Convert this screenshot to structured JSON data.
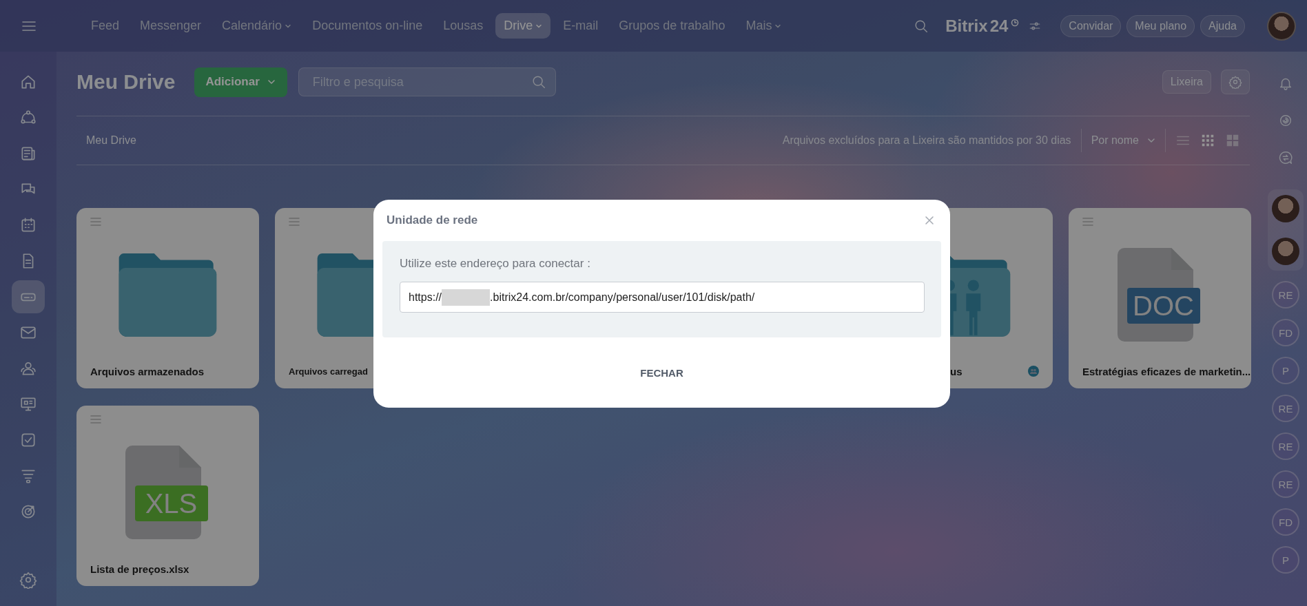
{
  "top_bar": {
    "nav": [
      {
        "label": "Feed",
        "dropdown": false,
        "selected": false
      },
      {
        "label": "Messenger",
        "dropdown": false,
        "selected": false
      },
      {
        "label": "Calendário",
        "dropdown": true,
        "selected": false
      },
      {
        "label": "Documentos on-line",
        "dropdown": false,
        "selected": false
      },
      {
        "label": "Lousas",
        "dropdown": false,
        "selected": false
      },
      {
        "label": "Drive",
        "dropdown": true,
        "selected": true
      },
      {
        "label": "E-mail",
        "dropdown": false,
        "selected": false
      },
      {
        "label": "Grupos de trabalho",
        "dropdown": false,
        "selected": false
      },
      {
        "label": "Mais",
        "dropdown": true,
        "selected": false
      }
    ],
    "logo": {
      "name": "Bitrix",
      "suffix": "24"
    },
    "buttons": [
      "Convidar",
      "Meu plano",
      "Ajuda"
    ]
  },
  "sidebar": {
    "items": [
      {
        "kind": "home",
        "selected": false
      },
      {
        "kind": "flow",
        "selected": false
      },
      {
        "kind": "news",
        "selected": false
      },
      {
        "kind": "chat",
        "selected": false
      },
      {
        "kind": "calendar",
        "selected": false
      },
      {
        "kind": "document",
        "selected": false
      },
      {
        "kind": "drive",
        "selected": true
      },
      {
        "kind": "mail",
        "selected": false
      },
      {
        "kind": "contacts",
        "selected": false
      },
      {
        "kind": "presentation",
        "selected": false
      },
      {
        "kind": "tasks",
        "selected": false
      },
      {
        "kind": "funnel",
        "selected": false
      },
      {
        "kind": "target",
        "selected": false
      },
      {
        "kind": "settings",
        "selected": false
      }
    ]
  },
  "page": {
    "title": "Meu Drive",
    "add_button": "Adicionar",
    "search": {
      "placeholder": "Filtro e pesquisa"
    },
    "trash_button": "Lixeira",
    "breadcrumb": "Meu Drive",
    "notice": "Arquivos excluídos para a Lixeira são mantidos por 30 dias",
    "sort": "Por nome",
    "views": [
      {
        "kind": "list",
        "selected": false
      },
      {
        "kind": "grid",
        "selected": true
      },
      {
        "kind": "tiles",
        "selected": false
      }
    ],
    "cards": [
      {
        "kind": "folder",
        "label": "Arquivos armazenados",
        "shared": false
      },
      {
        "kind": "folder",
        "label": "Arquivos carregad",
        "shared": false
      },
      {
        "kind": "people-folder",
        "label": "us",
        "shared": true
      },
      {
        "kind": "document",
        "badge": "DOC",
        "label": "Estratégias eficazes de marketin...",
        "shared": false
      },
      {
        "kind": "spreadsheet",
        "badge": "XLS",
        "label": "Lista de preços.xlsx",
        "shared": false
      }
    ]
  },
  "right_rail": {
    "tools": [
      {
        "kind": "bell"
      },
      {
        "kind": "spiral"
      },
      {
        "kind": "chat-arrows"
      }
    ],
    "contacts": [
      {
        "kind": "photo"
      },
      {
        "kind": "photo"
      },
      {
        "kind": "initials",
        "initials": "RE"
      },
      {
        "kind": "initials",
        "initials": "FD"
      },
      {
        "kind": "initials",
        "initials": "P"
      },
      {
        "kind": "initials",
        "initials": "RE"
      },
      {
        "kind": "initials",
        "initials": "RE"
      },
      {
        "kind": "initials",
        "initials": "RE"
      },
      {
        "kind": "initials",
        "initials": "FD"
      },
      {
        "kind": "initials",
        "initials": "P"
      }
    ]
  },
  "dialog": {
    "title": "Unidade de rede",
    "label": "Utilize este endereço para conectar :",
    "address_start": "https://",
    "address_end": ".bitrix24.com.br/company/personal/user/101/disk/path/",
    "close_button": "FECHAR"
  }
}
